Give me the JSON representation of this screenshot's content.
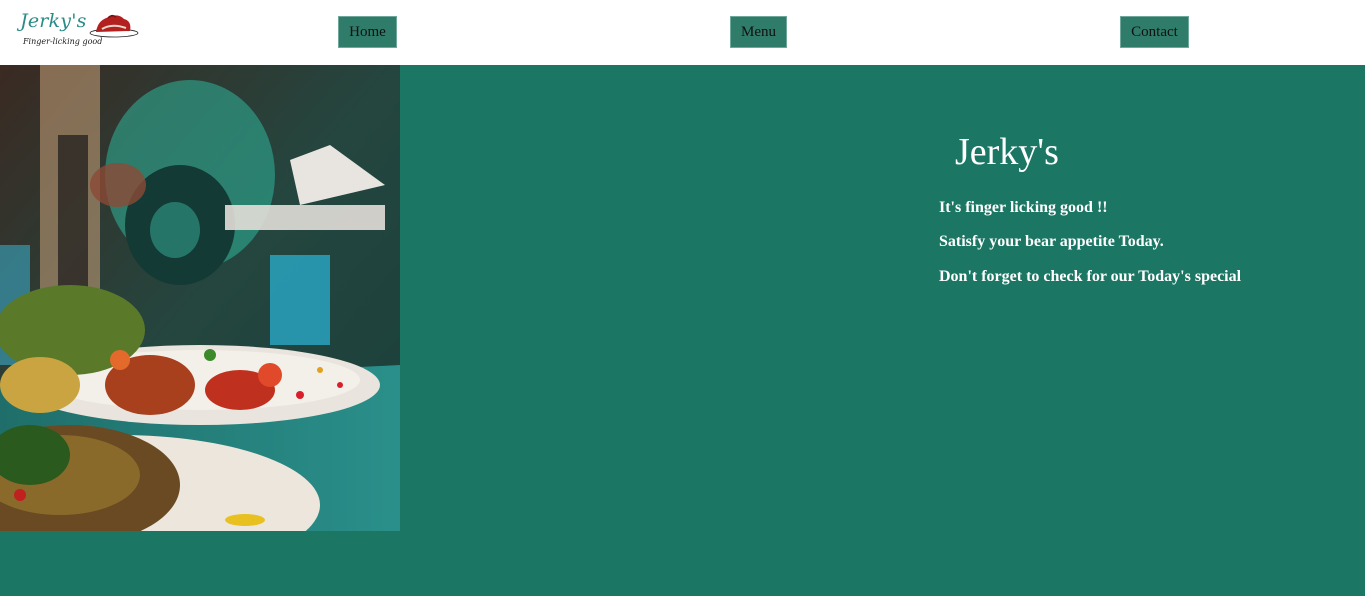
{
  "logo": {
    "title": "Jerky's",
    "tagline": "Finger-licking good",
    "icon": "chef-hat-icon"
  },
  "nav": {
    "home": "Home",
    "menu": "Menu",
    "contact": "Contact"
  },
  "hero": {
    "image": "food-plate-photo"
  },
  "intro": {
    "title": "Jerky's",
    "lines": [
      "It's finger licking good !!",
      "Satisfy your bear appetite Today.",
      "Don't forget to check for our Today's special"
    ]
  },
  "colors": {
    "background": "#1b7664",
    "header": "#ffffff",
    "button": "#2f7c6b",
    "logo_text": "#2a8c87"
  }
}
